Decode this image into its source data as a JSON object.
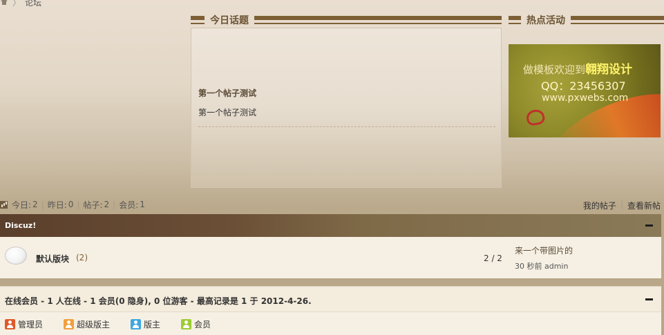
{
  "breadcrumb": {
    "home_icon": "home-icon",
    "separator": "〉",
    "current": "论坛"
  },
  "today_topics": {
    "title": "今日话题",
    "items": [
      {
        "title": "第一个帖子测试",
        "body": "第一个帖子测试"
      }
    ]
  },
  "hot_activity": {
    "title": "热点活动",
    "banner": {
      "line1_prefix": "做模板欢迎到",
      "line1_brand": "翱翔设计",
      "line2": "QQ：23456307",
      "line3": "www.pxwebs.com"
    }
  },
  "stats": {
    "today_label": "今日:",
    "today_value": "2",
    "yesterday_label": "昨日:",
    "yesterday_value": "0",
    "posts_label": "帖子:",
    "posts_value": "2",
    "members_label": "会员:",
    "members_value": "1"
  },
  "links": {
    "my_posts": "我的帖子",
    "new_posts": "查看新帖"
  },
  "category": {
    "name": "Discuz!",
    "forums": [
      {
        "name": "默认版块",
        "count": "(2)",
        "stat": "2 / 2",
        "last_post_title": "来一个带图片的",
        "last_post_meta": "30 秒前  admin"
      }
    ]
  },
  "online": {
    "summary": "在线会员 - 1 人在线 - 1 会员(0 隐身), 0 位游客 - 最高记录是 1 于 2012-4-26.",
    "legend": [
      {
        "label": "管理员",
        "color": "#e05a2a"
      },
      {
        "label": "超级版主",
        "color": "#f0a040"
      },
      {
        "label": "版主",
        "color": "#3fa7e0"
      },
      {
        "label": "会员",
        "color": "#9ccc35"
      }
    ]
  },
  "colors": {
    "accent_brown": "#7d5f35",
    "category_bar": "#5a3f2c",
    "row_bg": "#f6f0e4"
  }
}
